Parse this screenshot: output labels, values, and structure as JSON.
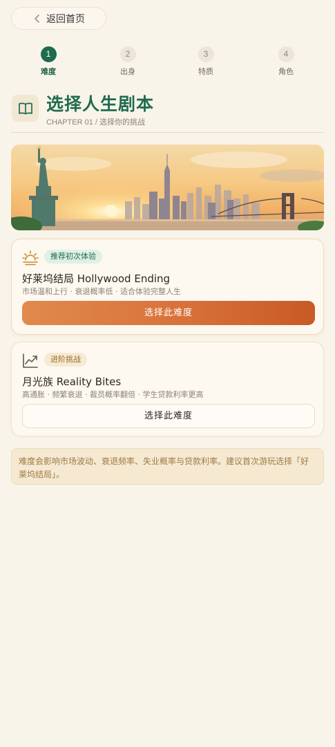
{
  "header": {
    "back_label": "返回首页"
  },
  "steps": [
    {
      "num": "1",
      "label": "难度",
      "active": true
    },
    {
      "num": "2",
      "label": "出身",
      "active": false
    },
    {
      "num": "3",
      "label": "特质",
      "active": false
    },
    {
      "num": "4",
      "label": "角色",
      "active": false
    }
  ],
  "page": {
    "title": "选择人生剧本",
    "subtitle": "CHAPTER 01 / 选择你的挑战",
    "title_icon": "book-icon",
    "banner_image": "new-york-skyline-sunset"
  },
  "difficulties": [
    {
      "icon": "sunrise-icon",
      "badge": "推荐初次体验",
      "title": "好莱坞结局 Hollywood Ending",
      "desc": "市场温和上行 · 衰退概率低 · 适合体验完整人生",
      "button": "选择此难度",
      "recommended": true
    },
    {
      "icon": "trending-up-icon",
      "badge": "进阶挑战",
      "title": "月光族 Reality Bites",
      "desc": "高通胀 · 频繁衰退 · 裁员概率翻倍 · 学生贷款利率更高",
      "button": "选择此难度",
      "recommended": false
    }
  ],
  "notice": "难度会影响市场波动、衰退频率、失业概率与贷款利率。建议首次游玩选择「好莱坞结局」。",
  "colors": {
    "background": "#f9f4ea",
    "primary_green": "#1f6b50",
    "accent_orange": "#d8713a",
    "notice_bg": "#f5e9d1"
  }
}
